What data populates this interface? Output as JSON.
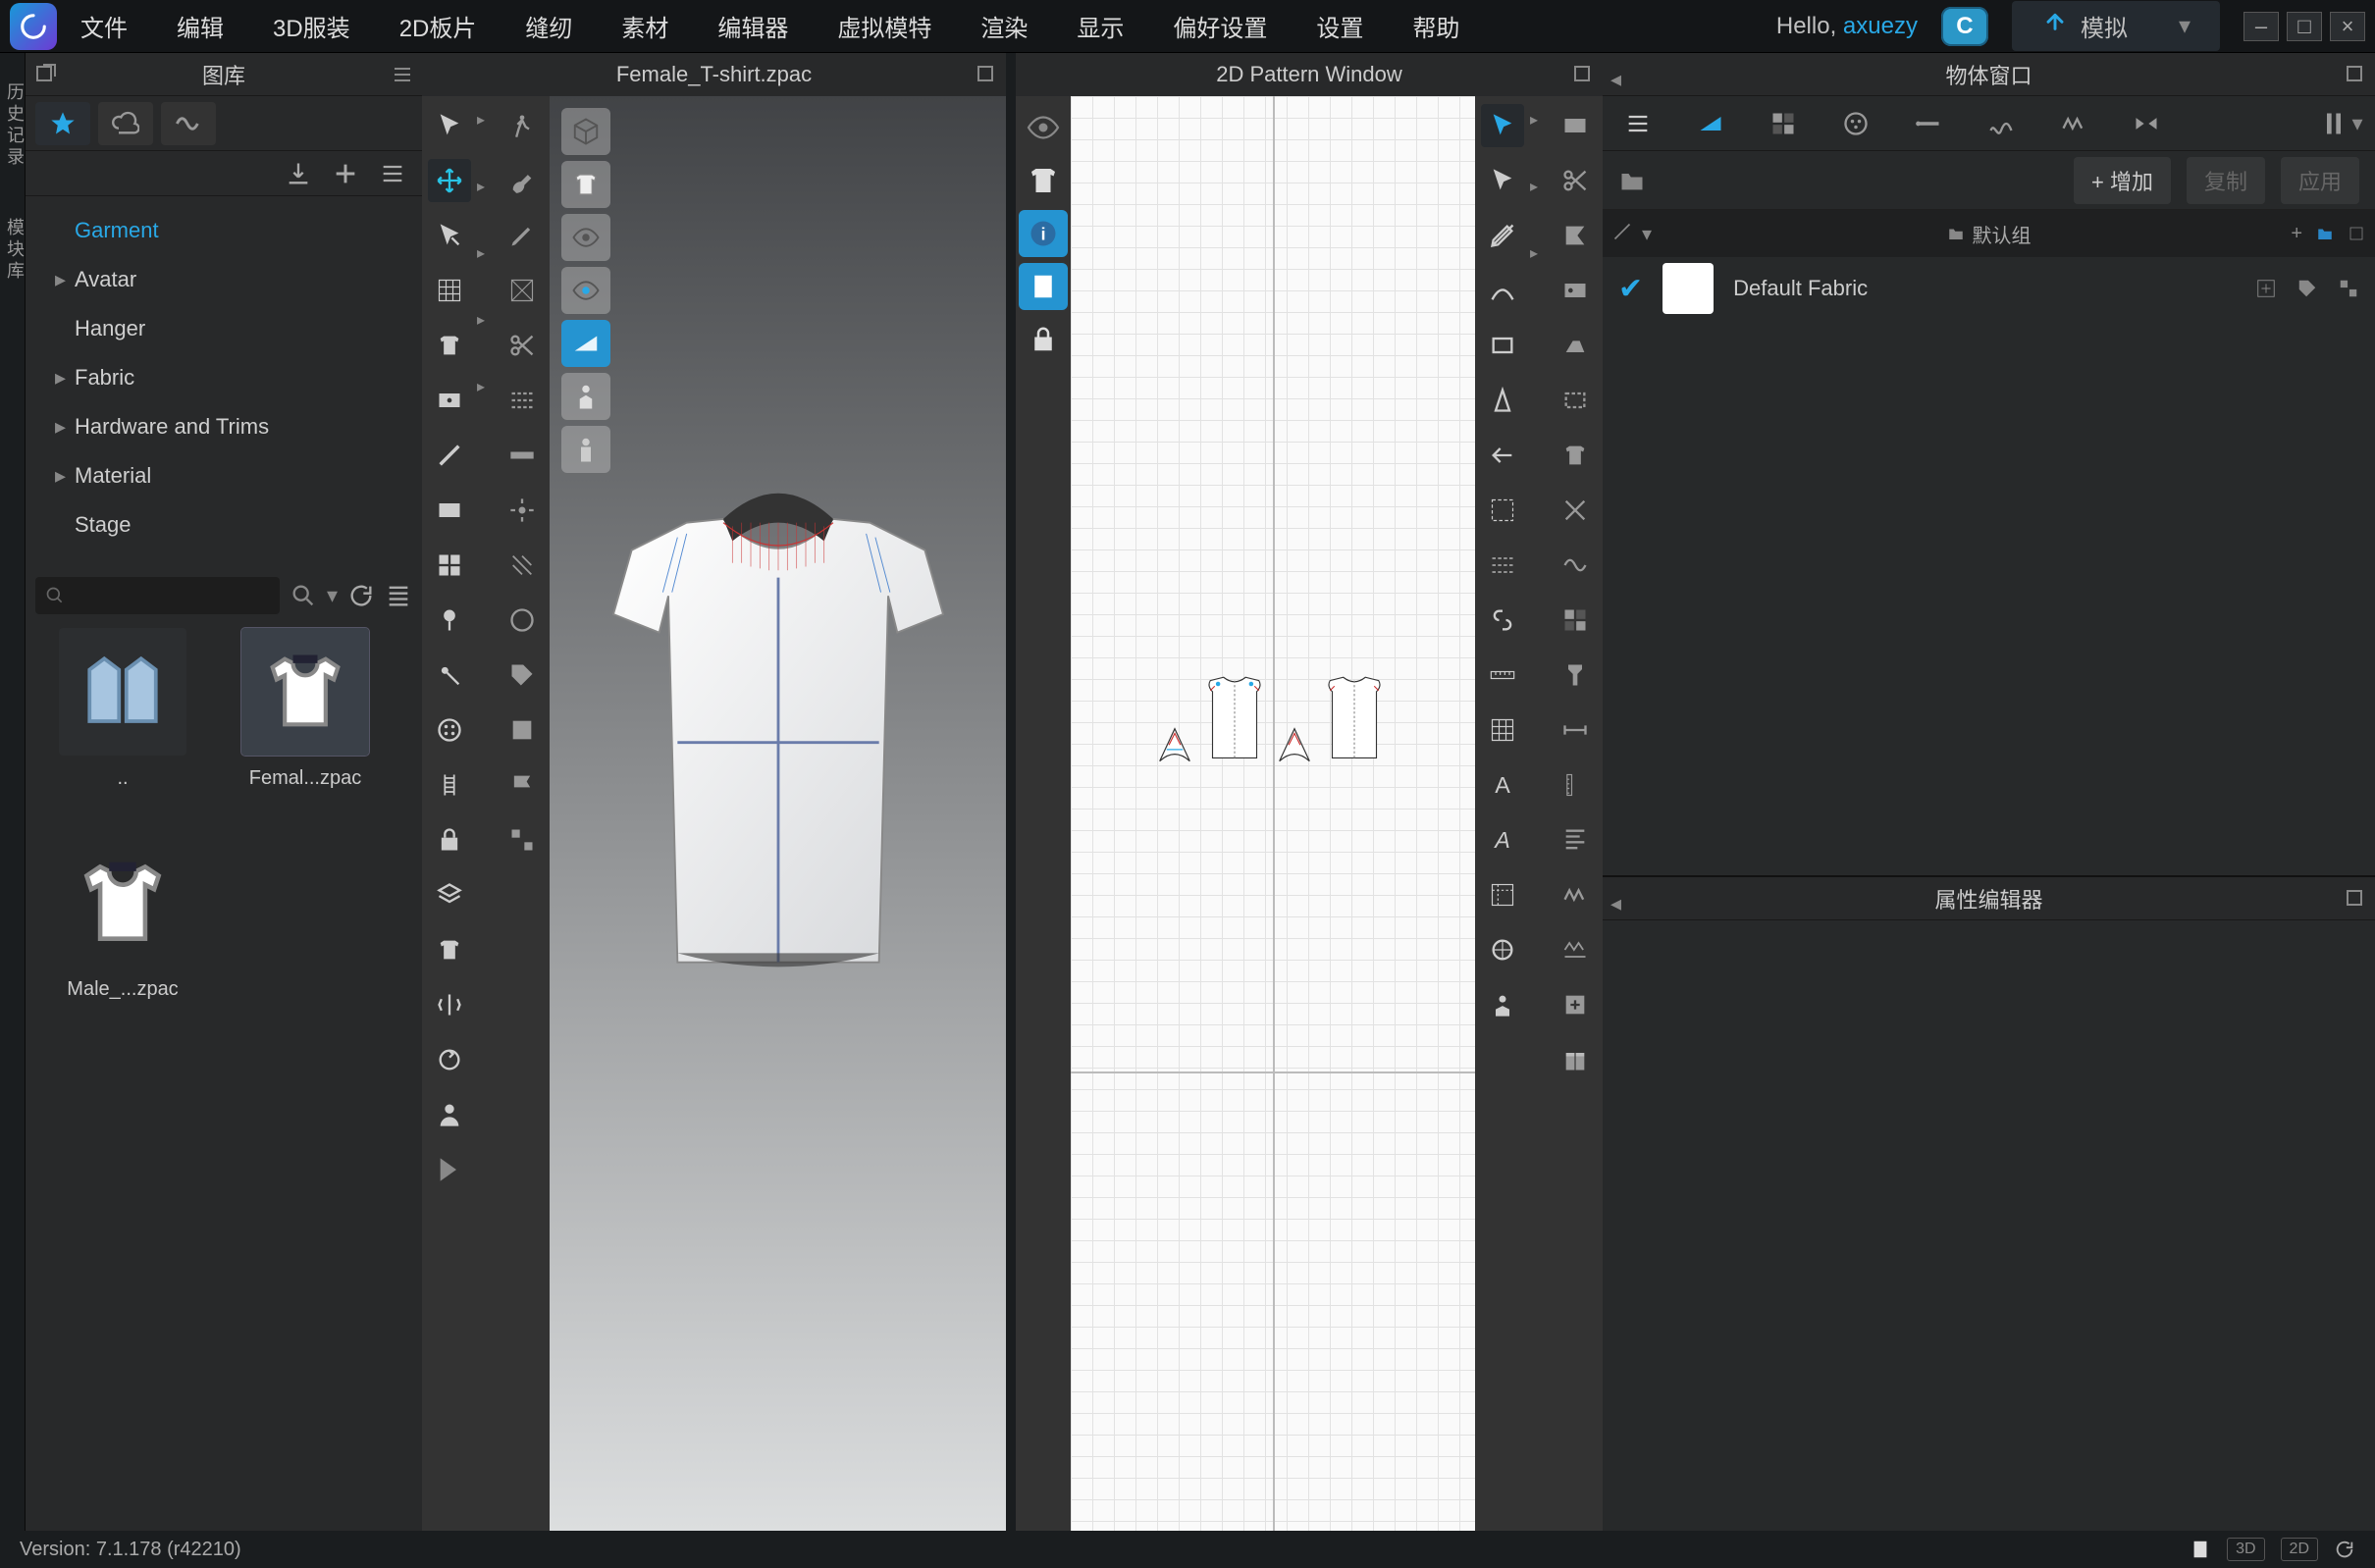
{
  "menu": {
    "items": [
      "文件",
      "编辑",
      "3D服装",
      "2D板片",
      "缝纫",
      "素材",
      "编辑器",
      "虚拟模特",
      "渲染",
      "显示",
      "偏好设置",
      "设置",
      "帮助"
    ],
    "hello_prefix": "Hello, ",
    "user": "axuezy",
    "simulate": "模拟"
  },
  "left_rail": {
    "tabs": [
      "历史记录",
      "模块库"
    ]
  },
  "library": {
    "title": "图库",
    "tree": [
      {
        "label": "Garment",
        "active": true,
        "expandable": false
      },
      {
        "label": "Avatar",
        "expandable": true
      },
      {
        "label": "Hanger",
        "expandable": false
      },
      {
        "label": "Fabric",
        "expandable": true
      },
      {
        "label": "Hardware and Trims",
        "expandable": true
      },
      {
        "label": "Material",
        "expandable": true
      },
      {
        "label": "Stage",
        "expandable": false
      }
    ],
    "thumbs": [
      {
        "label": "..",
        "kind": "folder"
      },
      {
        "label": "Femal...zpac",
        "kind": "garment",
        "selected": true
      },
      {
        "label": "Male_...zpac",
        "kind": "garment"
      }
    ]
  },
  "viewport3d": {
    "title": "Female_T-shirt.zpac"
  },
  "viewport2d": {
    "title": "2D Pattern Window"
  },
  "obj_window": {
    "title": "物体窗口",
    "add": "+ 增加",
    "copy": "复制",
    "apply": "应用",
    "group": "默认组",
    "fabric": "Default Fabric"
  },
  "prop_editor": {
    "title": "属性编辑器"
  },
  "status": {
    "version": "Version: 7.1.178 (r42210)",
    "chips": [
      "3D",
      "2D"
    ]
  }
}
